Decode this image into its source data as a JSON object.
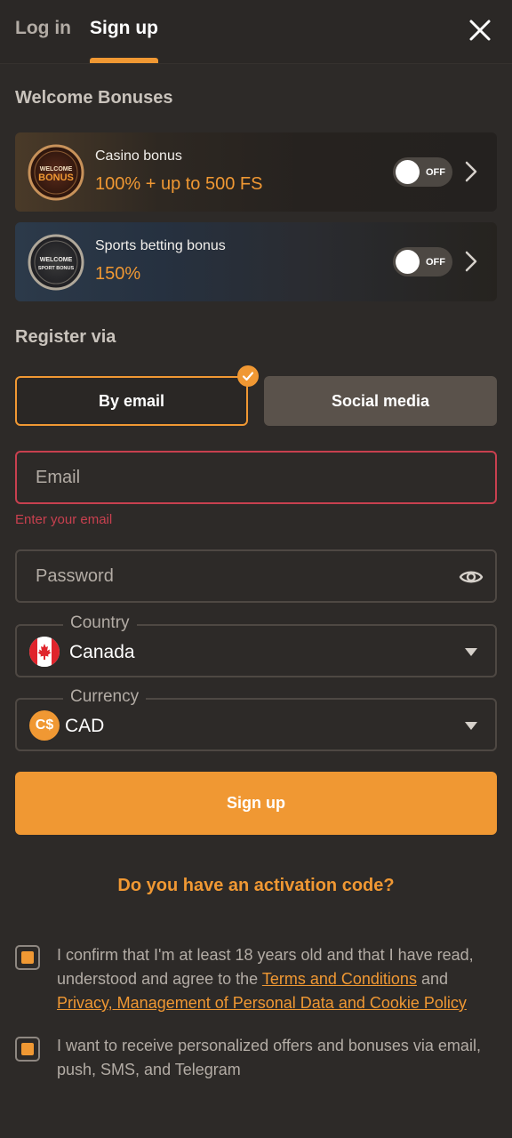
{
  "header": {
    "tabs": [
      {
        "label": "Log in"
      },
      {
        "label": "Sign up"
      }
    ]
  },
  "bonuses": {
    "title": "Welcome Bonuses",
    "items": [
      {
        "name": "Casino bonus",
        "value": "100% + up to 500 FS",
        "badge_line1": "WELCOME",
        "badge_line2": "BONUS",
        "toggle": "OFF"
      },
      {
        "name": "Sports betting bonus",
        "value": "150%",
        "badge_line1": "WELCOME",
        "badge_line2": "SPORT BONUS",
        "toggle": "OFF"
      }
    ]
  },
  "register": {
    "title": "Register via",
    "methods": [
      {
        "label": "By email",
        "selected": true
      },
      {
        "label": "Social media",
        "selected": false
      }
    ]
  },
  "form": {
    "email_placeholder": "Email",
    "email_error": "Enter your email",
    "password_placeholder": "Password",
    "country_label": "Country",
    "country_value": "Canada",
    "currency_label": "Currency",
    "currency_value": "CAD",
    "currency_symbol": "C$",
    "submit_label": "Sign up"
  },
  "activation_code_text": "Do you have an activation code?",
  "consents": {
    "age_text_before": "I confirm that I'm at least 18 years old and that I have read, understood and agree to the ",
    "terms_link": "Terms and Conditions",
    "and": " and ",
    "privacy_link": "Privacy, Management of Personal Data and Cookie Policy",
    "offers_text": "I want to receive personalized offers and bonuses via email, push, SMS, and Telegram"
  },
  "colors": {
    "accent": "#f09833",
    "error": "#c8404f",
    "background": "#2d2a28"
  }
}
